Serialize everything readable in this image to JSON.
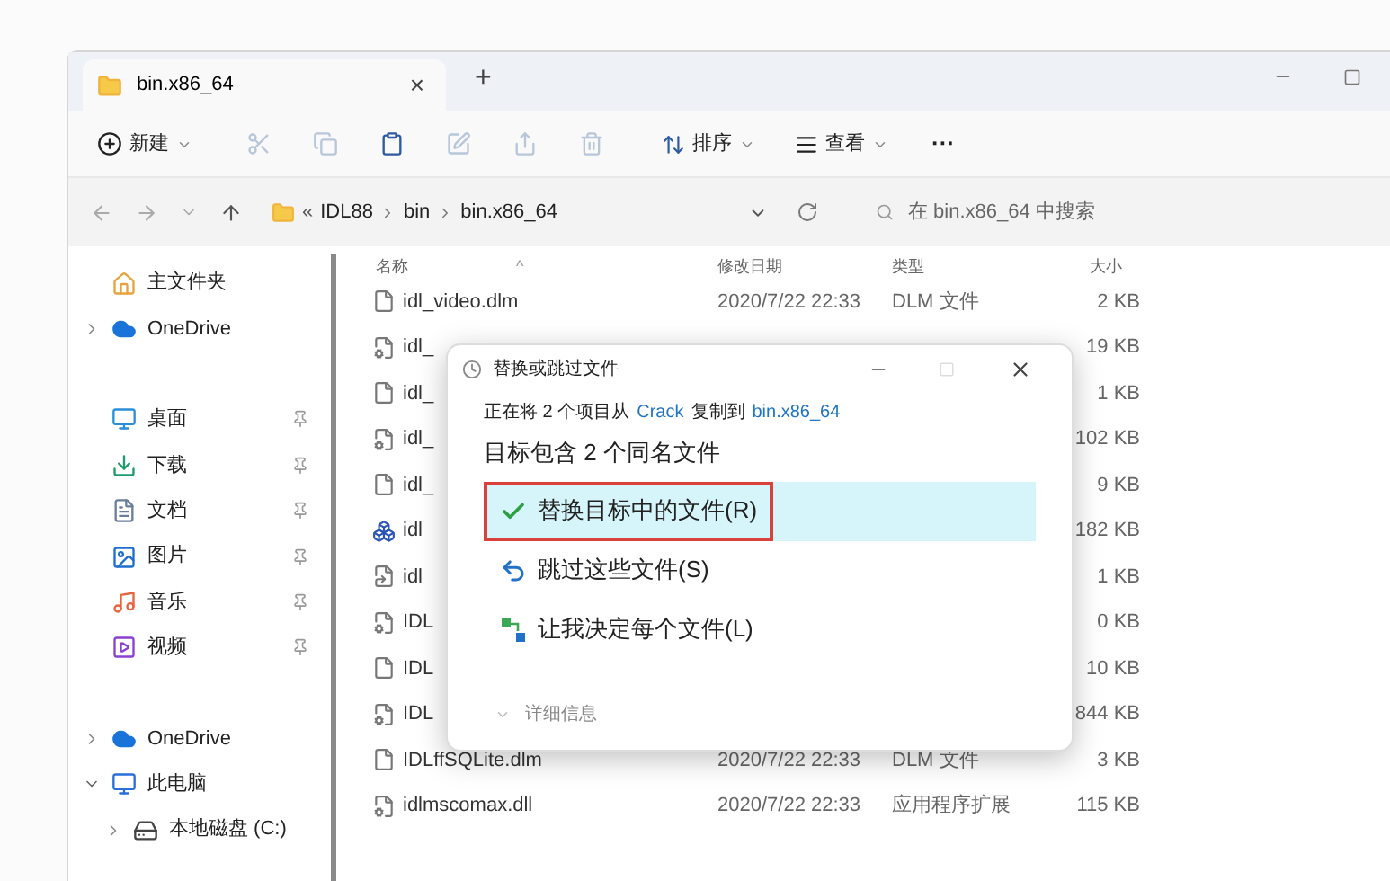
{
  "tab": {
    "title": "bin.x86_64",
    "close": "×",
    "new": "+"
  },
  "toolbar": {
    "new": "新建",
    "tools": [
      {
        "kind": "cut",
        "disabled": true
      },
      {
        "kind": "copy",
        "disabled": true
      },
      {
        "kind": "paste",
        "disabled": false
      },
      {
        "kind": "rename",
        "disabled": true
      },
      {
        "kind": "share",
        "disabled": true
      },
      {
        "kind": "delete",
        "disabled": true
      }
    ],
    "sort": "排序",
    "view": "查看",
    "more": "···"
  },
  "address": {
    "overflow": "«",
    "crumbs": [
      "IDL88",
      "bin",
      "bin.x86_64"
    ],
    "search_placeholder": "在 bin.x86_64 中搜索"
  },
  "sidebar": [
    {
      "kind": "home",
      "label": "主文件夹",
      "expandable": false,
      "expanded": false,
      "pinned": false
    },
    {
      "kind": "cloud",
      "label": "OneDrive",
      "expandable": true,
      "expanded": false,
      "pinned": false
    },
    {
      "kind": "gap"
    },
    {
      "kind": "desktop",
      "label": "桌面",
      "expandable": false,
      "expanded": false,
      "pinned": true
    },
    {
      "kind": "download",
      "label": "下载",
      "expandable": false,
      "expanded": false,
      "pinned": true
    },
    {
      "kind": "documents",
      "label": "文档",
      "expandable": false,
      "expanded": false,
      "pinned": true
    },
    {
      "kind": "pictures",
      "label": "图片",
      "expandable": false,
      "expanded": false,
      "pinned": true
    },
    {
      "kind": "music",
      "label": "音乐",
      "expandable": false,
      "expanded": false,
      "pinned": true
    },
    {
      "kind": "videos",
      "label": "视频",
      "expandable": false,
      "expanded": false,
      "pinned": true
    },
    {
      "kind": "gap"
    },
    {
      "kind": "cloud",
      "label": "OneDrive",
      "expandable": true,
      "expanded": false,
      "pinned": false
    },
    {
      "kind": "pc",
      "label": "此电脑",
      "expandable": true,
      "expanded": true,
      "pinned": false,
      "children": [
        {
          "kind": "drive",
          "label": "本地磁盘 (C:)",
          "expandable": true,
          "expanded": false,
          "pinned": false
        }
      ]
    }
  ],
  "columns": {
    "name": "名称",
    "sort_mark": "^",
    "date": "修改日期",
    "type": "类型",
    "size": "大小"
  },
  "files": [
    {
      "kind": "doc",
      "name": "idl_video.dlm",
      "date": "2020/7/22 22:33",
      "type": "DLM 文件",
      "size": "2 KB"
    },
    {
      "kind": "dll",
      "name": "idl_",
      "size": "19 KB"
    },
    {
      "kind": "doc",
      "name": "idl_",
      "size": "1 KB"
    },
    {
      "kind": "dll",
      "name": "idl_",
      "size": "102 KB"
    },
    {
      "kind": "doc",
      "name": "idl_",
      "size": "9 KB"
    },
    {
      "kind": "app",
      "name": "idl",
      "size": "182 KB"
    },
    {
      "kind": "link",
      "name": "idl",
      "size": "1 KB"
    },
    {
      "kind": "dll",
      "name": "IDL",
      "size": "0 KB"
    },
    {
      "kind": "doc",
      "name": "IDL",
      "size": "10 KB"
    },
    {
      "kind": "dll",
      "name": "IDL",
      "size": "844 KB"
    },
    {
      "kind": "doc",
      "name": "IDLffSQLite.dlm",
      "date": "2020/7/22 22:33",
      "type": "DLM 文件",
      "size": "3 KB"
    },
    {
      "kind": "dll",
      "name": "idlmscomax.dll",
      "date": "2020/7/22 22:33",
      "type": "应用程序扩展",
      "size": "115 KB"
    }
  ],
  "dialog": {
    "title": "替换或跳过文件",
    "copy_line": {
      "prefix": "正在将 2 个项目从",
      "source": "Crack",
      "middle": "复制到",
      "dest": "bin.x86_64"
    },
    "heading": "目标包含 2 个同名文件",
    "options": [
      {
        "kind": "replace",
        "label": "替换目标中的文件(R)",
        "selected": true,
        "marked": true
      },
      {
        "kind": "skip",
        "label": "跳过这些文件(S)",
        "selected": false,
        "marked": false
      },
      {
        "kind": "decide",
        "label": "让我决定每个文件(L)",
        "selected": false,
        "marked": false
      }
    ],
    "details": "详细信息"
  }
}
